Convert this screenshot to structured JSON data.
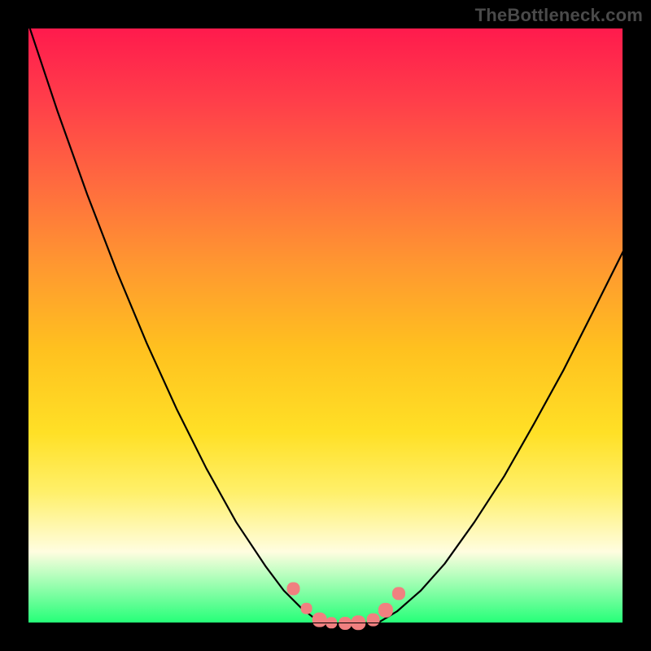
{
  "watermark": "TheBottleneck.com",
  "colors": {
    "curve": "#000000",
    "marker_fill": "#f08080",
    "marker_stroke": "#c06060",
    "gradient_top": "#ff1a4d",
    "gradient_bottom": "#23ff77",
    "frame": "#000000"
  },
  "chart_data": {
    "type": "line",
    "title": "",
    "xlabel": "",
    "ylabel": "",
    "xlim": [
      0,
      1
    ],
    "ylim": [
      0,
      1
    ],
    "grid": false,
    "legend": null,
    "series": [
      {
        "name": "left_bottleneck_curve",
        "x": [
          0.0,
          0.05,
          0.1,
          0.15,
          0.2,
          0.25,
          0.3,
          0.35,
          0.4,
          0.43,
          0.46,
          0.49
        ],
        "values": [
          1.01,
          0.86,
          0.72,
          0.59,
          0.47,
          0.36,
          0.26,
          0.17,
          0.095,
          0.055,
          0.025,
          0.002
        ]
      },
      {
        "name": "flat_region",
        "x": [
          0.49,
          0.52,
          0.56,
          0.59
        ],
        "values": [
          0.002,
          0.0,
          0.0,
          0.002
        ]
      },
      {
        "name": "right_bottleneck_curve",
        "x": [
          0.59,
          0.62,
          0.66,
          0.7,
          0.75,
          0.8,
          0.85,
          0.9,
          0.95,
          1.0
        ],
        "values": [
          0.002,
          0.02,
          0.055,
          0.1,
          0.17,
          0.247,
          0.335,
          0.426,
          0.525,
          0.625
        ]
      },
      {
        "name": "markers",
        "x": [
          0.446,
          0.468,
          0.49,
          0.51,
          0.533,
          0.555,
          0.58,
          0.601,
          0.623
        ],
        "values": [
          0.058,
          0.025,
          0.006,
          0.001,
          0.0,
          0.001,
          0.006,
          0.022,
          0.05
        ],
        "sizes": [
          8,
          7,
          9,
          7,
          8,
          9,
          8,
          9,
          8
        ]
      }
    ]
  }
}
